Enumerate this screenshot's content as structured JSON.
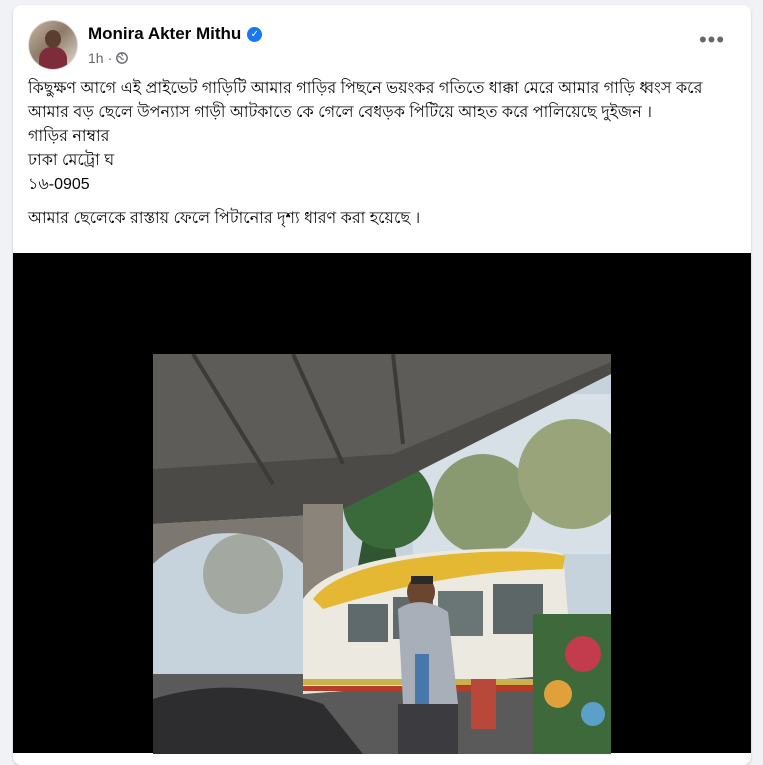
{
  "post": {
    "author": "Monira Akter Mithu",
    "verified_icon": "verified-badge-icon",
    "time": "1h",
    "separator": "·",
    "privacy_icon": "globe-icon",
    "more_icon": "more-options-icon",
    "more_glyph": "•••",
    "lines": [
      "কিছুক্ষণ আগে এই প্রাইভেট গাড়িটি আমার গাড়ির পিছনে ভয়ংকর গতিতে ধাক্কা মেরে আমার গাড়ি ধ্বংস করে আমার বড় ছেলে উপন্যাস গাড়ী আটকাতে কে গেলে বেধড়ক পিটিয়ে আহত করে পালিয়েছে দুইজন ।",
      "গাড়ির নাম্বার",
      "ঢাকা মেট্রো ঘ",
      "১৬-0905"
    ],
    "final_line": "আমার ছেলেকে রাস্তায় ফেলে পিটানোর দৃশ্য ধারণ করা হয়েছে ।"
  },
  "colors": {
    "accent": "#1877f2",
    "background": "#f0f2f5",
    "secondary_text": "#65676b"
  }
}
